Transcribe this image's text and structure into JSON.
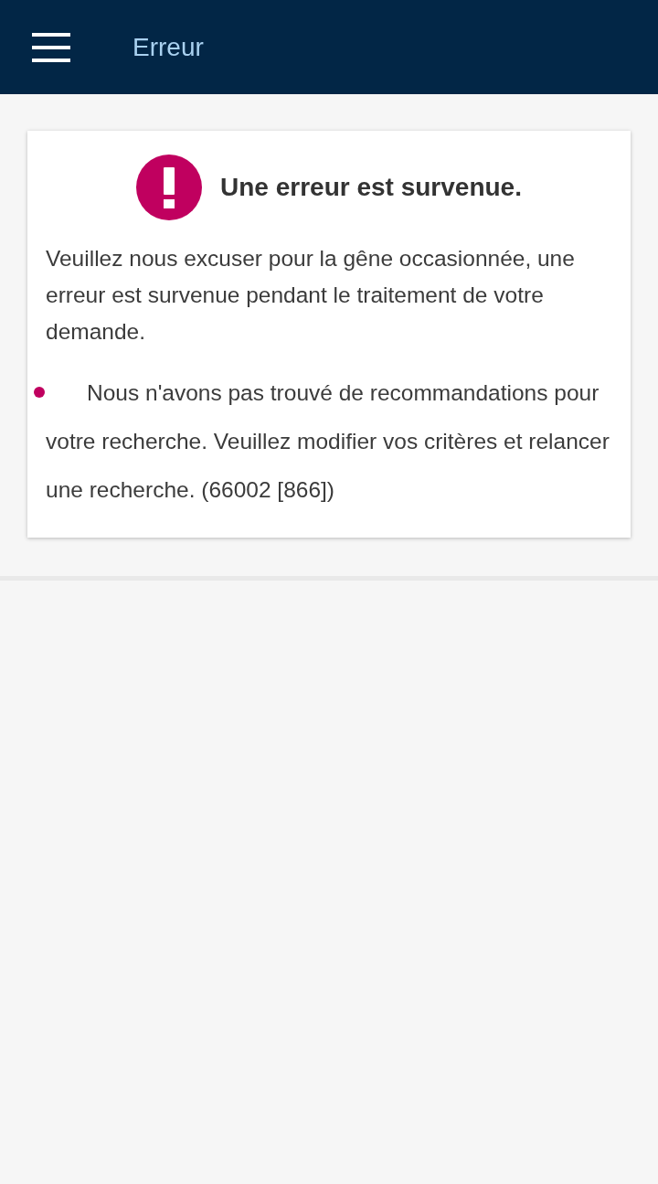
{
  "header": {
    "title": "Erreur"
  },
  "error_card": {
    "heading": "Une erreur est survenue.",
    "message": "Veuillez nous excuser pour la gêne occasionnée, une erreur est survenue pendant le traitement de votre demande.",
    "details": [
      "Nous n'avons pas trouvé de recommandations pour votre recherche. Veuillez modifier vos critères et relancer une recherche. (66002 [866])"
    ]
  }
}
